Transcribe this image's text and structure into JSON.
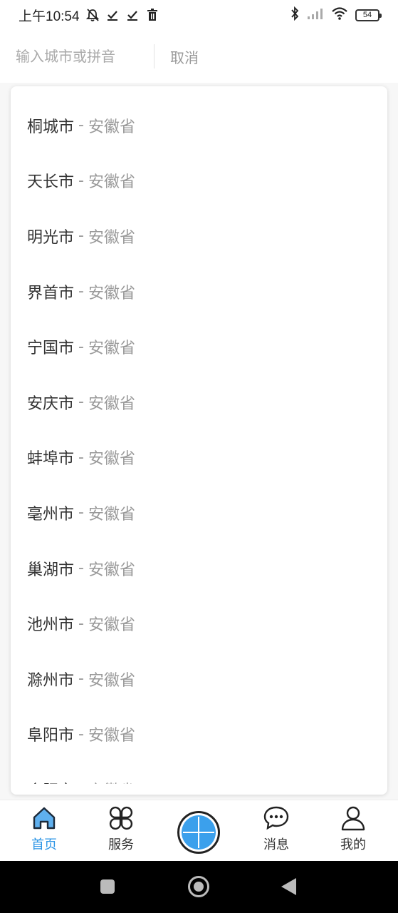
{
  "status_bar": {
    "time": "上午10:54",
    "icons_left": [
      "mute-icon",
      "check-icon",
      "check-icon",
      "trash-icon"
    ],
    "icons_right": [
      "bluetooth-icon",
      "signal-icon",
      "wifi-icon"
    ],
    "battery": "54"
  },
  "search": {
    "placeholder": "输入城市或拼音",
    "value": "",
    "cancel_label": "取消"
  },
  "city_list": {
    "separator": "-",
    "items": [
      {
        "city": "桐城市",
        "province": "安徽省"
      },
      {
        "city": "天长市",
        "province": "安徽省"
      },
      {
        "city": "明光市",
        "province": "安徽省"
      },
      {
        "city": "界首市",
        "province": "安徽省"
      },
      {
        "city": "宁国市",
        "province": "安徽省"
      },
      {
        "city": "安庆市",
        "province": "安徽省"
      },
      {
        "city": "蚌埠市",
        "province": "安徽省"
      },
      {
        "city": "亳州市",
        "province": "安徽省"
      },
      {
        "city": "巢湖市",
        "province": "安徽省"
      },
      {
        "city": "池州市",
        "province": "安徽省"
      },
      {
        "city": "滁州市",
        "province": "安徽省"
      },
      {
        "city": "阜阳市",
        "province": "安徽省"
      },
      {
        "city": "合肥市",
        "province": "安徽省"
      }
    ]
  },
  "bottom_nav": {
    "accent_color": "#2c95e6",
    "items": [
      {
        "label": "首页",
        "icon": "home-icon",
        "active": true
      },
      {
        "label": "服务",
        "icon": "services-icon",
        "active": false
      },
      {
        "label": "消息",
        "icon": "message-icon",
        "active": false
      },
      {
        "label": "我的",
        "icon": "user-icon",
        "active": false
      }
    ],
    "center_icon": "add-icon"
  }
}
